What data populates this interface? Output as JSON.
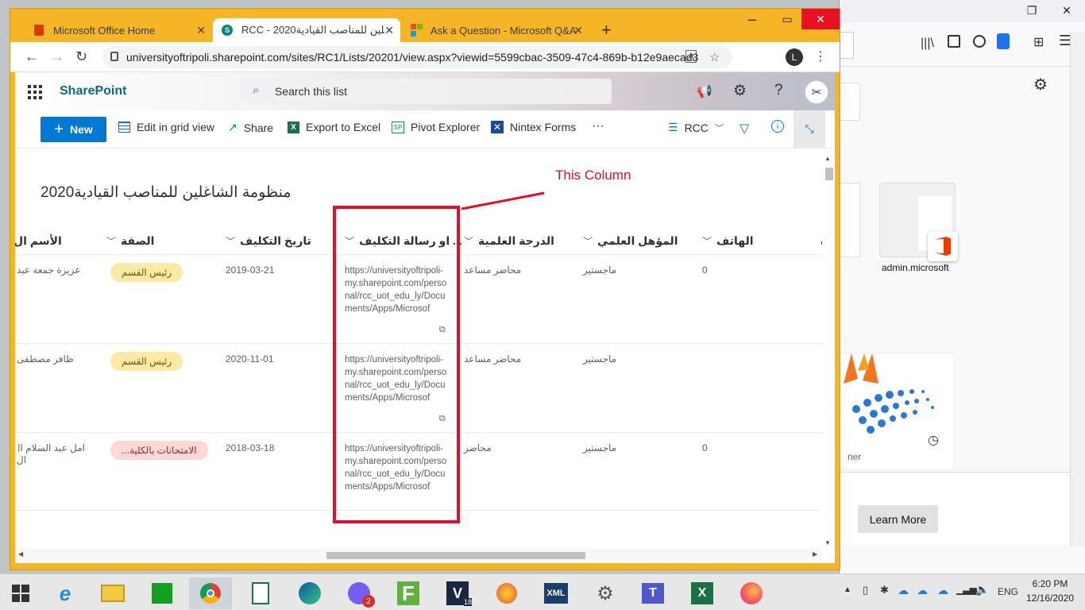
{
  "browser": {
    "tabs": [
      {
        "title": "Microsoft Office Home",
        "active": false
      },
      {
        "title": "RCC - 2020غلين للمناصب القيادية",
        "active": true
      },
      {
        "title": "Ask a Question - Microsoft Q&A",
        "active": false
      }
    ],
    "new_tab_symbol": "+",
    "url": "universityoftripoli.sharepoint.com/sites/RC1/Lists/20201/view.aspx?viewid=5599cbac-3509-47c4-869b-b12e9aecad3e",
    "profile_initial": "L"
  },
  "sharepoint": {
    "brand": "SharePoint",
    "search_placeholder": "Search this list",
    "commands": {
      "new": "New",
      "edit_grid": "Edit in grid view",
      "share": "Share",
      "export": "Export to Excel",
      "pivot": "Pivot Explorer",
      "nintex": "Nintex Forms",
      "more": "···",
      "view": "RCC"
    },
    "list_title": "منظومة الشاغلين للمناصب القيادية2020",
    "annotation": "This Column",
    "columns": {
      "name": "الأسم ال",
      "title": "الصفة",
      "date": "تاريخ التكليف",
      "letter": "... او رسالة التكليف",
      "degree": "الدرجة العلمية",
      "qual": "المؤهل العلمي",
      "phone": "الهاتف"
    },
    "rows": [
      {
        "name": "عزيزة جمعة عبد",
        "title": "رئيس القسم",
        "date": "2019-03-21",
        "url": "https://universityoftripoli-my.sharepoint.com/personal/rcc_uot_edu_ly/Documents/Apps/Microsof",
        "degree": "محاضر مساعد",
        "qual": "ماجستير",
        "phone": "0"
      },
      {
        "name": "ظافر مصطفى",
        "title": "رئيس القسم",
        "date": "2020-11-01",
        "url": "https://universityoftripoli-my.sharepoint.com/personal/rcc_uot_edu_ly/Documents/Apps/Microsof",
        "degree": "محاضر مساعد",
        "qual": "ماجستير",
        "phone": ""
      },
      {
        "name": "امل عبد السلام ال",
        "name2": "ال",
        "title": "الامتحانات بالكلية...",
        "date": "2018-03-18",
        "url": "https://universityoftripoli-my.sharepoint.com/personal/rcc_uot_edu_ly/Documents/Apps/Microsof",
        "degree": "محاضر",
        "qual": "ماجستير",
        "phone": "0"
      }
    ]
  },
  "background_window": {
    "tile_label": "admin.microsoft",
    "partial_text": "ner",
    "learn_more": "Learn More"
  },
  "taskbar": {
    "time": "6:20 PM",
    "date": "12/16/2020",
    "lang": "ENG",
    "viber_badge": "2",
    "vs_badge": "18"
  },
  "colors": {
    "chrome_frame": "#f5b526",
    "sp_blue": "#0078d4",
    "annotation_red": "#e0102a",
    "pill_yellow": "#fce9a6",
    "pill_pink": "#fdd8d4"
  }
}
